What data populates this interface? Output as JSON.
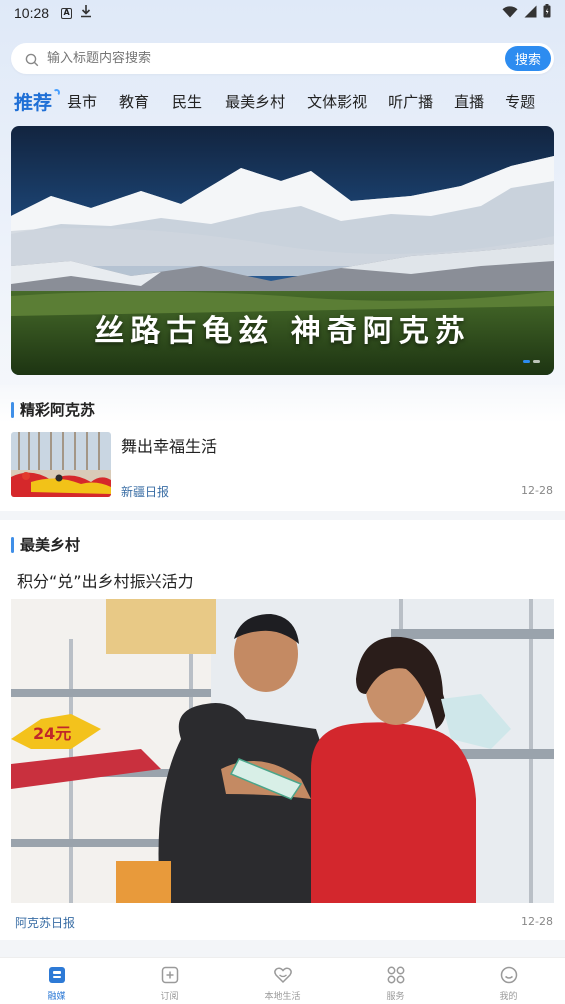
{
  "status_bar": {
    "time": "10:28",
    "a_icon_label": "A"
  },
  "search": {
    "placeholder": "输入标题内容搜索",
    "button_label": "搜索"
  },
  "channels": [
    "推荐",
    "县市",
    "教育",
    "民生",
    "最美乡村",
    "文体影视",
    "听广播",
    "直播",
    "专题"
  ],
  "banner": {
    "caption": "丝路古龟兹 神奇阿克苏",
    "slide_count": 2,
    "active_slide": 1
  },
  "section_1": {
    "title": "精彩阿克苏",
    "item": {
      "title": "舞出幸福生活",
      "source": "新疆日报",
      "time": "12-28"
    }
  },
  "section_2": {
    "title": "最美乡村",
    "item": {
      "title": "积分“兑”出乡村振兴活力",
      "source": "阿克苏日报",
      "time": "12-28",
      "sign_text": "24元"
    }
  },
  "bottom_nav": [
    {
      "label": "融媒",
      "icon": "media-icon",
      "active": true
    },
    {
      "label": "订阅",
      "icon": "subscribe-icon",
      "active": false
    },
    {
      "label": "本地生活",
      "icon": "heart-icon",
      "active": false
    },
    {
      "label": "服务",
      "icon": "grid-icon",
      "active": false
    },
    {
      "label": "我的",
      "icon": "profile-icon",
      "active": false
    }
  ],
  "colors": {
    "accent": "#2d8cf0",
    "tab_active": "#1f6fd6",
    "source_text": "#3a6ea5"
  }
}
